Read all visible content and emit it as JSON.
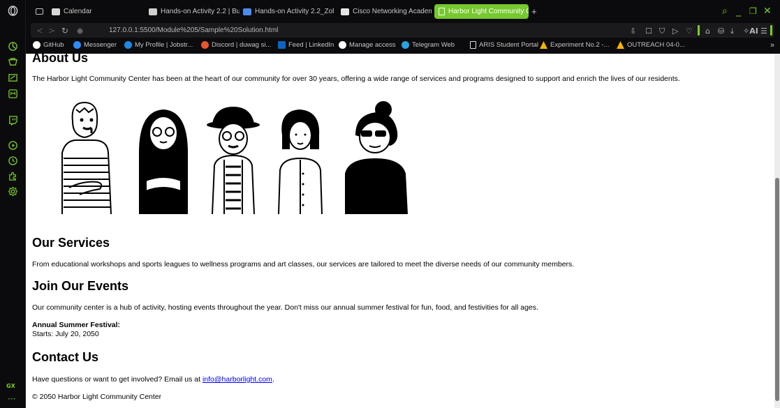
{
  "browser": {
    "tabs": [
      {
        "label": "",
        "icon": "image-icon"
      },
      {
        "label": "Calendar",
        "icon": "calendar-icon"
      },
      {
        "label": "Hands-on Activity 2.2 | Bu",
        "icon": "doc-icon"
      },
      {
        "label": "Hands-on Activity 2.2_Zol",
        "icon": "doc-icon"
      },
      {
        "label": "Cisco Networking Academ",
        "icon": "cisco-icon"
      },
      {
        "label": "Harbor Light Community C",
        "icon": "page-icon",
        "active": true
      }
    ],
    "url": "127.0.0.1:5500/Module%205/Sample%20Solution.html",
    "bookmarks": [
      {
        "label": "GitHub",
        "color": "#ffffff"
      },
      {
        "label": "Messenger",
        "color": "#2b8cff"
      },
      {
        "label": "My Profile | Jobstr...",
        "color": "#1e88e5"
      },
      {
        "label": "Discord | duwag si...",
        "color": "#e8542c"
      },
      {
        "label": "Feed | LinkedIn",
        "color": "#0a66c2"
      },
      {
        "label": "Manage access",
        "color": "#ffffff"
      },
      {
        "label": "Telegram Web",
        "color": "#2aa3e0"
      },
      {
        "label": "ARIS Student Portal",
        "color": "#dddddd"
      },
      {
        "label": "Experiment No.2 -...",
        "color": "#f4b400"
      },
      {
        "label": "OUTREACH 04-0...",
        "color": "#f4b400"
      }
    ],
    "ai_label": "AI",
    "sidebar_label": "GX",
    "accent": "#7acd2c"
  },
  "page": {
    "about": {
      "heading": "About Us",
      "text": "The Harbor Light Community Center has been at the heart of our community for over 30 years, offering a wide range of services and programs designed to support and enrich the lives of our residents."
    },
    "services": {
      "heading": "Our Services",
      "text": "From educational workshops and sports leagues to wellness programs and art classes, our services are tailored to meet the diverse needs of our community members."
    },
    "events": {
      "heading": "Join Our Events",
      "text": "Our community center is a hub of activity, hosting events throughout the year. Don't miss our annual summer festival for fun, food, and festivities for all ages.",
      "festival_title": "Annual Summer Festival:",
      "festival_date": "Starts: July 20, 2050"
    },
    "contact": {
      "heading": "Contact Us",
      "text_before": "Have questions or want to get involved? Email us at ",
      "email": "info@harborlight.com",
      "text_after": "."
    },
    "footer": "© 2050 Harbor Light Community Center"
  }
}
